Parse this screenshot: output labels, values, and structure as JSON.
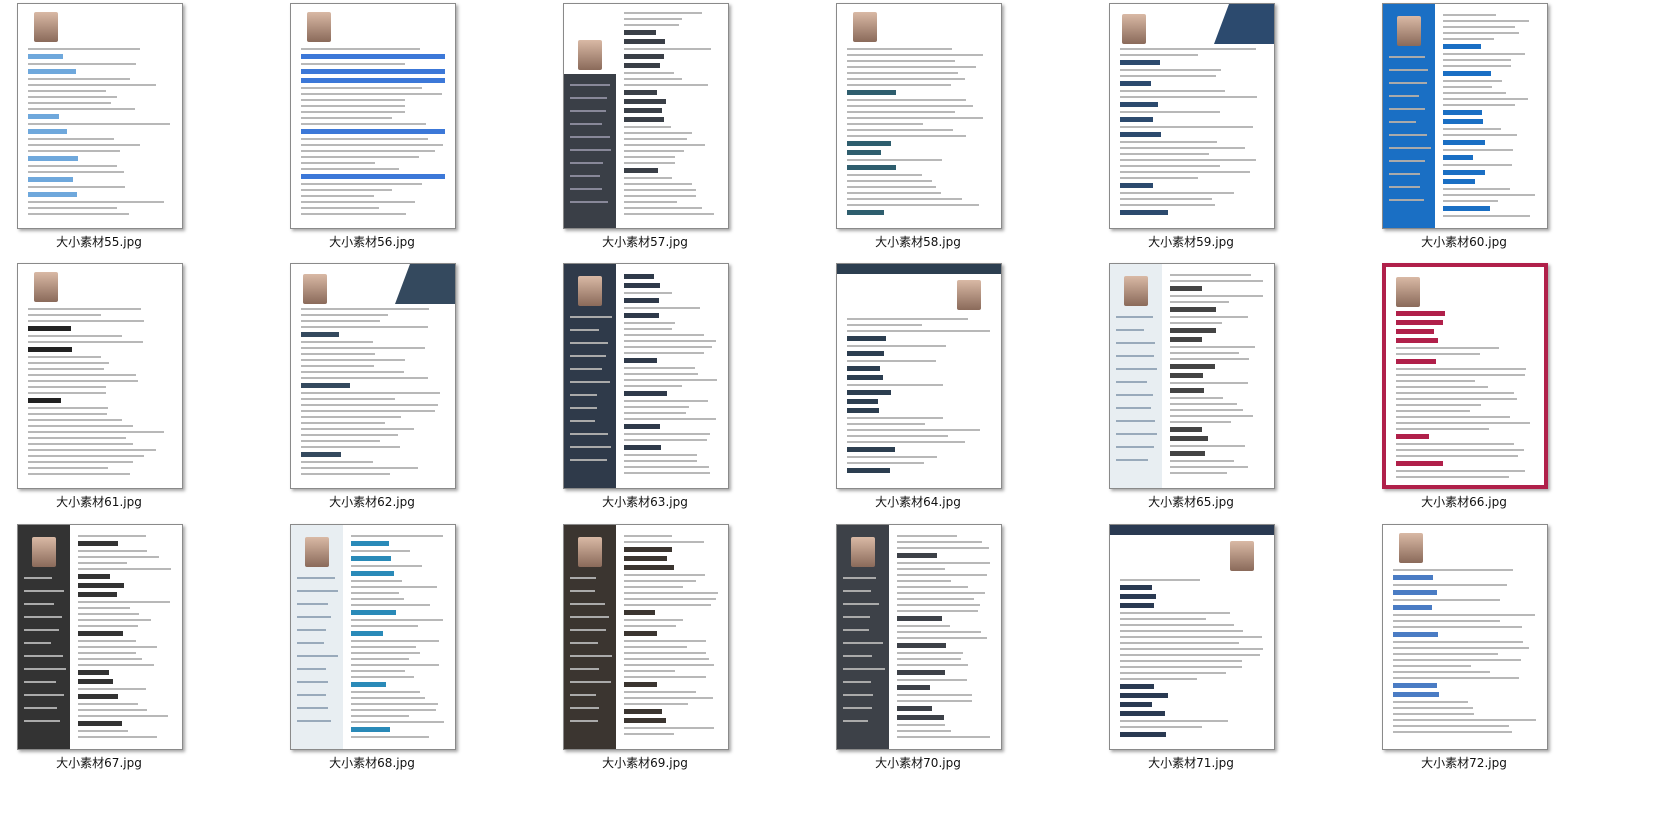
{
  "files": [
    {
      "name": "大小素材55.jpg",
      "layout": "plain",
      "accent": "#6fa8dc"
    },
    {
      "name": "大小素材56.jpg",
      "layout": "bars",
      "accent": "#3c78d8"
    },
    {
      "name": "大小素材57.jpg",
      "layout": "side-right-dark",
      "accent": "#3a3f47"
    },
    {
      "name": "大小素材58.jpg",
      "layout": "plain",
      "accent": "#2e5e6e"
    },
    {
      "name": "大小素材59.jpg",
      "layout": "banner",
      "accent": "#2c4a6e"
    },
    {
      "name": "大小素材60.jpg",
      "layout": "side-left",
      "accent": "#1a6fc4"
    },
    {
      "name": "大小素材61.jpg",
      "layout": "plain",
      "accent": "#222222"
    },
    {
      "name": "大小素材62.jpg",
      "layout": "banner",
      "accent": "#34495e"
    },
    {
      "name": "大小素材63.jpg",
      "layout": "side-left",
      "accent": "#2f3a4a"
    },
    {
      "name": "大小素材64.jpg",
      "layout": "top",
      "accent": "#2c3e50"
    },
    {
      "name": "大小素材65.jpg",
      "layout": "side-left-light",
      "accent": "#444444"
    },
    {
      "name": "大小素材66.jpg",
      "layout": "framed",
      "accent": "#b0204a"
    },
    {
      "name": "大小素材67.jpg",
      "layout": "side-left",
      "accent": "#333333"
    },
    {
      "name": "大小素材68.jpg",
      "layout": "side-left-light",
      "accent": "#2a8ab8"
    },
    {
      "name": "大小素材69.jpg",
      "layout": "side-left",
      "accent": "#3b3530"
    },
    {
      "name": "大小素材70.jpg",
      "layout": "side-left",
      "accent": "#3d4148"
    },
    {
      "name": "大小素材71.jpg",
      "layout": "top",
      "accent": "#2a3a52"
    },
    {
      "name": "大小素材72.jpg",
      "layout": "plain",
      "accent": "#4a7cc4"
    }
  ]
}
